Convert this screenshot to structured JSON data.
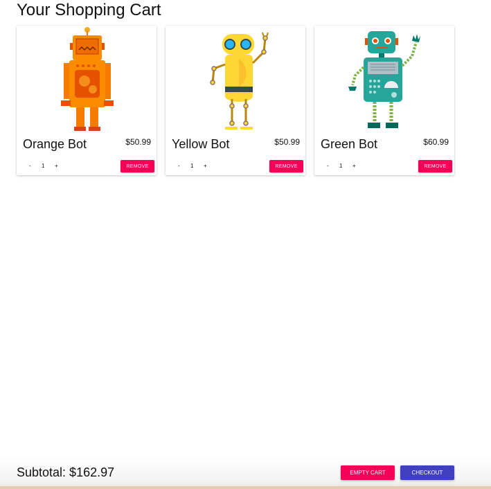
{
  "page": {
    "title": "Your Shopping Cart"
  },
  "items": [
    {
      "name": "Orange Bot",
      "price": "$50.99",
      "quantity": "1",
      "remove_label": "REMOVE",
      "minus_label": "-",
      "plus_label": "+",
      "image_icon": "orange-robot-icon"
    },
    {
      "name": "Yellow Bot",
      "price": "$50.99",
      "quantity": "1",
      "remove_label": "REMOVE",
      "minus_label": "-",
      "plus_label": "+",
      "image_icon": "yellow-robot-icon"
    },
    {
      "name": "Green Bot",
      "price": "$60.99",
      "quantity": "1",
      "remove_label": "REMOVE",
      "minus_label": "-",
      "plus_label": "+",
      "image_icon": "green-robot-icon"
    }
  ],
  "footer": {
    "subtotal": "Subtotal: $162.97",
    "empty_cart_label": "EMPTY CART",
    "checkout_label": "CHECKOUT"
  },
  "colors": {
    "accent_pink": "#f50057",
    "primary_indigo": "#3f3fbf"
  }
}
